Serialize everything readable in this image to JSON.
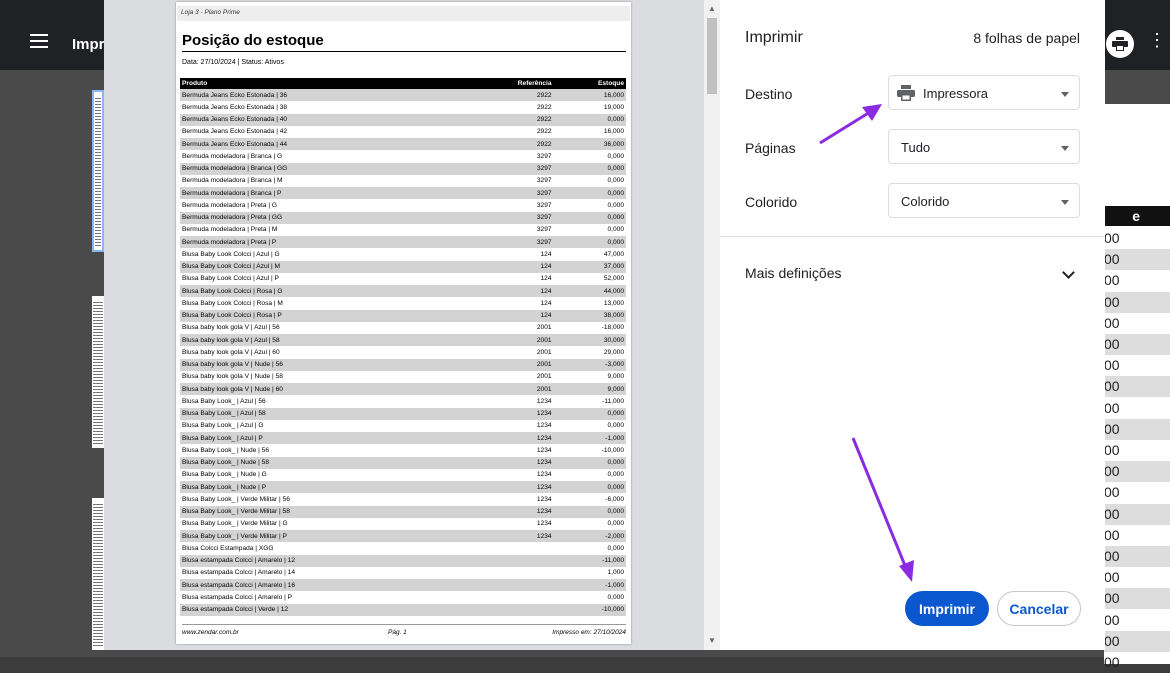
{
  "background_app": {
    "title": "Impr",
    "right_column_header": "e",
    "right_column_values": [
      "00",
      "00",
      "00",
      "00",
      "00",
      "00",
      "00",
      "00",
      "00",
      "00",
      "00",
      "00",
      "00",
      "00",
      "00",
      "00",
      "00",
      "00",
      "00",
      "00",
      "00"
    ]
  },
  "preview": {
    "store": "Loja 3 - Plano Prime",
    "title": "Posição do estoque",
    "meta": "Data: 27/10/2024 | Status: Ativos",
    "columns": {
      "produto": "Produto",
      "referencia": "Referência",
      "estoque": "Estoque"
    },
    "rows": [
      [
        "Bermuda Jeans Ecko Estonada | 36",
        "2922",
        "16,000"
      ],
      [
        "Bermuda Jeans Ecko Estonada | 38",
        "2922",
        "19,000"
      ],
      [
        "Bermuda Jeans Ecko Estonada | 40",
        "2922",
        "0,000"
      ],
      [
        "Bermuda Jeans Ecko Estonada | 42",
        "2922",
        "16,000"
      ],
      [
        "Bermuda Jeans Ecko Estonada | 44",
        "2922",
        "36,000"
      ],
      [
        "Bermuda modeladora | Branca | G",
        "3297",
        "0,000"
      ],
      [
        "Bermuda modeladora | Branca | GG",
        "3297",
        "0,000"
      ],
      [
        "Bermuda modeladora | Branca | M",
        "3297",
        "0,000"
      ],
      [
        "Bermuda modeladora | Branca | P",
        "3297",
        "0,000"
      ],
      [
        "Bermuda modeladora | Preta | G",
        "3297",
        "0,000"
      ],
      [
        "Bermuda modeladora | Preta | GG",
        "3297",
        "0,000"
      ],
      [
        "Bermuda modeladora | Preta | M",
        "3297",
        "0,000"
      ],
      [
        "Bermuda modeladora | Preta | P",
        "3297",
        "0,000"
      ],
      [
        "Blusa Baby Look Colcci | Azul | G",
        "124",
        "47,000"
      ],
      [
        "Blusa Baby Look Colcci | Azul | M",
        "124",
        "37,000"
      ],
      [
        "Blusa Baby Look Colcci | Azul | P",
        "124",
        "52,000"
      ],
      [
        "Blusa Baby Look Colcci | Rosa | G",
        "124",
        "44,000"
      ],
      [
        "Blusa Baby Look Colcci | Rosa | M",
        "124",
        "13,000"
      ],
      [
        "Blusa Baby Look Colcci | Rosa | P",
        "124",
        "38,000"
      ],
      [
        "Blusa baby look gola V | Azul | 56",
        "2001",
        "-18,000"
      ],
      [
        "Blusa baby look gola V | Azul | 58",
        "2001",
        "30,000"
      ],
      [
        "Blusa baby look gola V | Azul | 60",
        "2001",
        "29,000"
      ],
      [
        "Blusa baby look gola V | Nude | 56",
        "2001",
        "-3,000"
      ],
      [
        "Blusa baby look gola V | Nude | 58",
        "2001",
        "9,000"
      ],
      [
        "Blusa baby look gola V | Nude | 60",
        "2001",
        "9,000"
      ],
      [
        "Blusa Baby Look_ | Azul | 56",
        "1234",
        "-11,000"
      ],
      [
        "Blusa Baby Look_ | Azul | 58",
        "1234",
        "0,000"
      ],
      [
        "Blusa Baby Look_ | Azul | G",
        "1234",
        "0,000"
      ],
      [
        "Blusa Baby Look_ | Azul | P",
        "1234",
        "-1,000"
      ],
      [
        "Blusa Baby Look_ | Nude | 56",
        "1234",
        "-10,000"
      ],
      [
        "Blusa Baby Look_ | Nude | 58",
        "1234",
        "0,000"
      ],
      [
        "Blusa Baby Look_ | Nude | G",
        "1234",
        "0,000"
      ],
      [
        "Blusa Baby Look_ | Nude | P",
        "1234",
        "0,000"
      ],
      [
        "Blusa Baby Look_ | Verde Militar | 56",
        "1234",
        "-6,000"
      ],
      [
        "Blusa Baby Look_ | Verde Militar | 58",
        "1234",
        "0,000"
      ],
      [
        "Blusa Baby Look_ | Verde Militar | G",
        "1234",
        "0,000"
      ],
      [
        "Blusa Baby Look_ | Verde Militar | P",
        "1234",
        "-2,000"
      ],
      [
        "Blusa Colcci Estampada | XGG",
        "",
        "0,000"
      ],
      [
        "Blusa estampada Colcci | Amarelo | 12",
        "",
        "-11,000"
      ],
      [
        "Blusa estampada Colcci | Amarelo | 14",
        "",
        "1,000"
      ],
      [
        "Blusa estampada Colcci | Amarelo | 16",
        "",
        "-1,000"
      ],
      [
        "Blusa estampada Colcci | Amarelo | P",
        "",
        "0,000"
      ],
      [
        "Blusa estampada Colcci | Verde | 12",
        "",
        "-10,000"
      ]
    ],
    "footer": {
      "site": "www.zendar.com.br",
      "page": "Pág. 1",
      "printed": "Impresso em: 27/10/2024"
    }
  },
  "print_panel": {
    "title": "Imprimir",
    "sheet_count": "8 folhas de papel",
    "destination": {
      "label": "Destino",
      "value": "Impressora"
    },
    "pages": {
      "label": "Páginas",
      "value": "Tudo"
    },
    "color": {
      "label": "Colorido",
      "value": "Colorido"
    },
    "more_settings": "Mais definições",
    "print_button": "Imprimir",
    "cancel_button": "Cancelar"
  },
  "colors": {
    "accent": "#0b57d0",
    "annotation_arrow": "#8a2be2"
  }
}
